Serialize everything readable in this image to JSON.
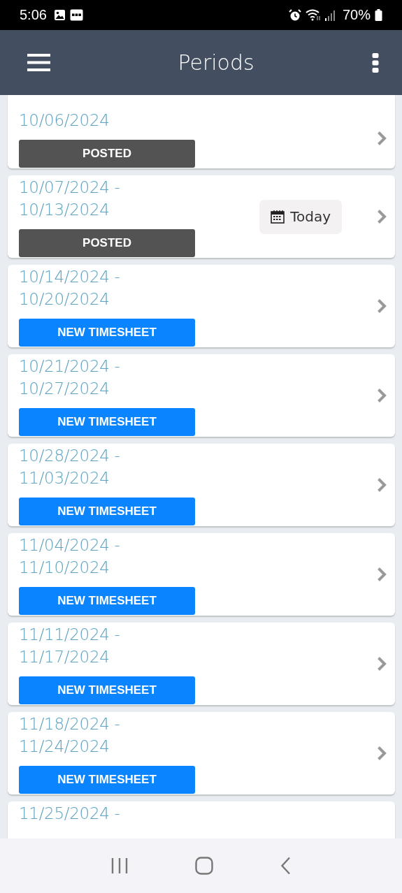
{
  "status_bar": {
    "time": "5:06",
    "battery": "70%"
  },
  "app_bar": {
    "title": "Periods"
  },
  "periods": [
    {
      "kind": "cut-top",
      "end": "10/06/2024",
      "status": {
        "kind": "posted",
        "label": "POSTED"
      }
    },
    {
      "kind": "full",
      "start": "10/07/2024 -",
      "end": "10/13/2024",
      "status": {
        "kind": "posted",
        "label": "POSTED"
      },
      "today": "Today"
    },
    {
      "kind": "full",
      "start": "10/14/2024 -",
      "end": "10/20/2024",
      "status": {
        "kind": "new",
        "label": "NEW TIMESHEET"
      }
    },
    {
      "kind": "full",
      "start": "10/21/2024 -",
      "end": "10/27/2024",
      "status": {
        "kind": "new",
        "label": "NEW TIMESHEET"
      }
    },
    {
      "kind": "full",
      "start": "10/28/2024 -",
      "end": "11/03/2024",
      "status": {
        "kind": "new",
        "label": "NEW TIMESHEET"
      }
    },
    {
      "kind": "full",
      "start": "11/04/2024 -",
      "end": "11/10/2024",
      "status": {
        "kind": "new",
        "label": "NEW TIMESHEET"
      }
    },
    {
      "kind": "full",
      "start": "11/11/2024 -",
      "end": "11/17/2024",
      "status": {
        "kind": "new",
        "label": "NEW TIMESHEET"
      }
    },
    {
      "kind": "full",
      "start": "11/18/2024 -",
      "end": "11/24/2024",
      "status": {
        "kind": "new",
        "label": "NEW TIMESHEET"
      }
    },
    {
      "kind": "cut-bottom",
      "start": "11/25/2024 -"
    }
  ]
}
